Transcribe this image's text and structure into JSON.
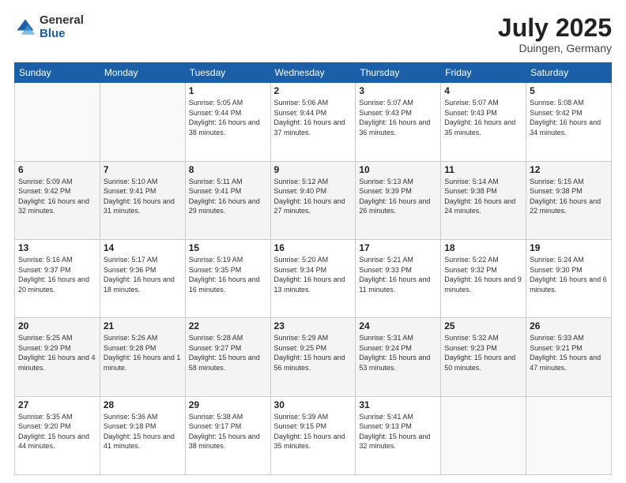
{
  "logo": {
    "general": "General",
    "blue": "Blue"
  },
  "header": {
    "month_year": "July 2025",
    "location": "Duingen, Germany"
  },
  "weekdays": [
    "Sunday",
    "Monday",
    "Tuesday",
    "Wednesday",
    "Thursday",
    "Friday",
    "Saturday"
  ],
  "weeks": [
    [
      {
        "day": "",
        "sunrise": "",
        "sunset": "",
        "daylight": ""
      },
      {
        "day": "",
        "sunrise": "",
        "sunset": "",
        "daylight": ""
      },
      {
        "day": "1",
        "sunrise": "Sunrise: 5:05 AM",
        "sunset": "Sunset: 9:44 PM",
        "daylight": "Daylight: 16 hours and 38 minutes."
      },
      {
        "day": "2",
        "sunrise": "Sunrise: 5:06 AM",
        "sunset": "Sunset: 9:44 PM",
        "daylight": "Daylight: 16 hours and 37 minutes."
      },
      {
        "day": "3",
        "sunrise": "Sunrise: 5:07 AM",
        "sunset": "Sunset: 9:43 PM",
        "daylight": "Daylight: 16 hours and 36 minutes."
      },
      {
        "day": "4",
        "sunrise": "Sunrise: 5:07 AM",
        "sunset": "Sunset: 9:43 PM",
        "daylight": "Daylight: 16 hours and 35 minutes."
      },
      {
        "day": "5",
        "sunrise": "Sunrise: 5:08 AM",
        "sunset": "Sunset: 9:42 PM",
        "daylight": "Daylight: 16 hours and 34 minutes."
      }
    ],
    [
      {
        "day": "6",
        "sunrise": "Sunrise: 5:09 AM",
        "sunset": "Sunset: 9:42 PM",
        "daylight": "Daylight: 16 hours and 32 minutes."
      },
      {
        "day": "7",
        "sunrise": "Sunrise: 5:10 AM",
        "sunset": "Sunset: 9:41 PM",
        "daylight": "Daylight: 16 hours and 31 minutes."
      },
      {
        "day": "8",
        "sunrise": "Sunrise: 5:11 AM",
        "sunset": "Sunset: 9:41 PM",
        "daylight": "Daylight: 16 hours and 29 minutes."
      },
      {
        "day": "9",
        "sunrise": "Sunrise: 5:12 AM",
        "sunset": "Sunset: 9:40 PM",
        "daylight": "Daylight: 16 hours and 27 minutes."
      },
      {
        "day": "10",
        "sunrise": "Sunrise: 5:13 AM",
        "sunset": "Sunset: 9:39 PM",
        "daylight": "Daylight: 16 hours and 26 minutes."
      },
      {
        "day": "11",
        "sunrise": "Sunrise: 5:14 AM",
        "sunset": "Sunset: 9:38 PM",
        "daylight": "Daylight: 16 hours and 24 minutes."
      },
      {
        "day": "12",
        "sunrise": "Sunrise: 5:15 AM",
        "sunset": "Sunset: 9:38 PM",
        "daylight": "Daylight: 16 hours and 22 minutes."
      }
    ],
    [
      {
        "day": "13",
        "sunrise": "Sunrise: 5:16 AM",
        "sunset": "Sunset: 9:37 PM",
        "daylight": "Daylight: 16 hours and 20 minutes."
      },
      {
        "day": "14",
        "sunrise": "Sunrise: 5:17 AM",
        "sunset": "Sunset: 9:36 PM",
        "daylight": "Daylight: 16 hours and 18 minutes."
      },
      {
        "day": "15",
        "sunrise": "Sunrise: 5:19 AM",
        "sunset": "Sunset: 9:35 PM",
        "daylight": "Daylight: 16 hours and 16 minutes."
      },
      {
        "day": "16",
        "sunrise": "Sunrise: 5:20 AM",
        "sunset": "Sunset: 9:34 PM",
        "daylight": "Daylight: 16 hours and 13 minutes."
      },
      {
        "day": "17",
        "sunrise": "Sunrise: 5:21 AM",
        "sunset": "Sunset: 9:33 PM",
        "daylight": "Daylight: 16 hours and 11 minutes."
      },
      {
        "day": "18",
        "sunrise": "Sunrise: 5:22 AM",
        "sunset": "Sunset: 9:32 PM",
        "daylight": "Daylight: 16 hours and 9 minutes."
      },
      {
        "day": "19",
        "sunrise": "Sunrise: 5:24 AM",
        "sunset": "Sunset: 9:30 PM",
        "daylight": "Daylight: 16 hours and 6 minutes."
      }
    ],
    [
      {
        "day": "20",
        "sunrise": "Sunrise: 5:25 AM",
        "sunset": "Sunset: 9:29 PM",
        "daylight": "Daylight: 16 hours and 4 minutes."
      },
      {
        "day": "21",
        "sunrise": "Sunrise: 5:26 AM",
        "sunset": "Sunset: 9:28 PM",
        "daylight": "Daylight: 16 hours and 1 minute."
      },
      {
        "day": "22",
        "sunrise": "Sunrise: 5:28 AM",
        "sunset": "Sunset: 9:27 PM",
        "daylight": "Daylight: 15 hours and 58 minutes."
      },
      {
        "day": "23",
        "sunrise": "Sunrise: 5:29 AM",
        "sunset": "Sunset: 9:25 PM",
        "daylight": "Daylight: 15 hours and 56 minutes."
      },
      {
        "day": "24",
        "sunrise": "Sunrise: 5:31 AM",
        "sunset": "Sunset: 9:24 PM",
        "daylight": "Daylight: 15 hours and 53 minutes."
      },
      {
        "day": "25",
        "sunrise": "Sunrise: 5:32 AM",
        "sunset": "Sunset: 9:23 PM",
        "daylight": "Daylight: 15 hours and 50 minutes."
      },
      {
        "day": "26",
        "sunrise": "Sunrise: 5:33 AM",
        "sunset": "Sunset: 9:21 PM",
        "daylight": "Daylight: 15 hours and 47 minutes."
      }
    ],
    [
      {
        "day": "27",
        "sunrise": "Sunrise: 5:35 AM",
        "sunset": "Sunset: 9:20 PM",
        "daylight": "Daylight: 15 hours and 44 minutes."
      },
      {
        "day": "28",
        "sunrise": "Sunrise: 5:36 AM",
        "sunset": "Sunset: 9:18 PM",
        "daylight": "Daylight: 15 hours and 41 minutes."
      },
      {
        "day": "29",
        "sunrise": "Sunrise: 5:38 AM",
        "sunset": "Sunset: 9:17 PM",
        "daylight": "Daylight: 15 hours and 38 minutes."
      },
      {
        "day": "30",
        "sunrise": "Sunrise: 5:39 AM",
        "sunset": "Sunset: 9:15 PM",
        "daylight": "Daylight: 15 hours and 35 minutes."
      },
      {
        "day": "31",
        "sunrise": "Sunrise: 5:41 AM",
        "sunset": "Sunset: 9:13 PM",
        "daylight": "Daylight: 15 hours and 32 minutes."
      },
      {
        "day": "",
        "sunrise": "",
        "sunset": "",
        "daylight": ""
      },
      {
        "day": "",
        "sunrise": "",
        "sunset": "",
        "daylight": ""
      }
    ]
  ]
}
